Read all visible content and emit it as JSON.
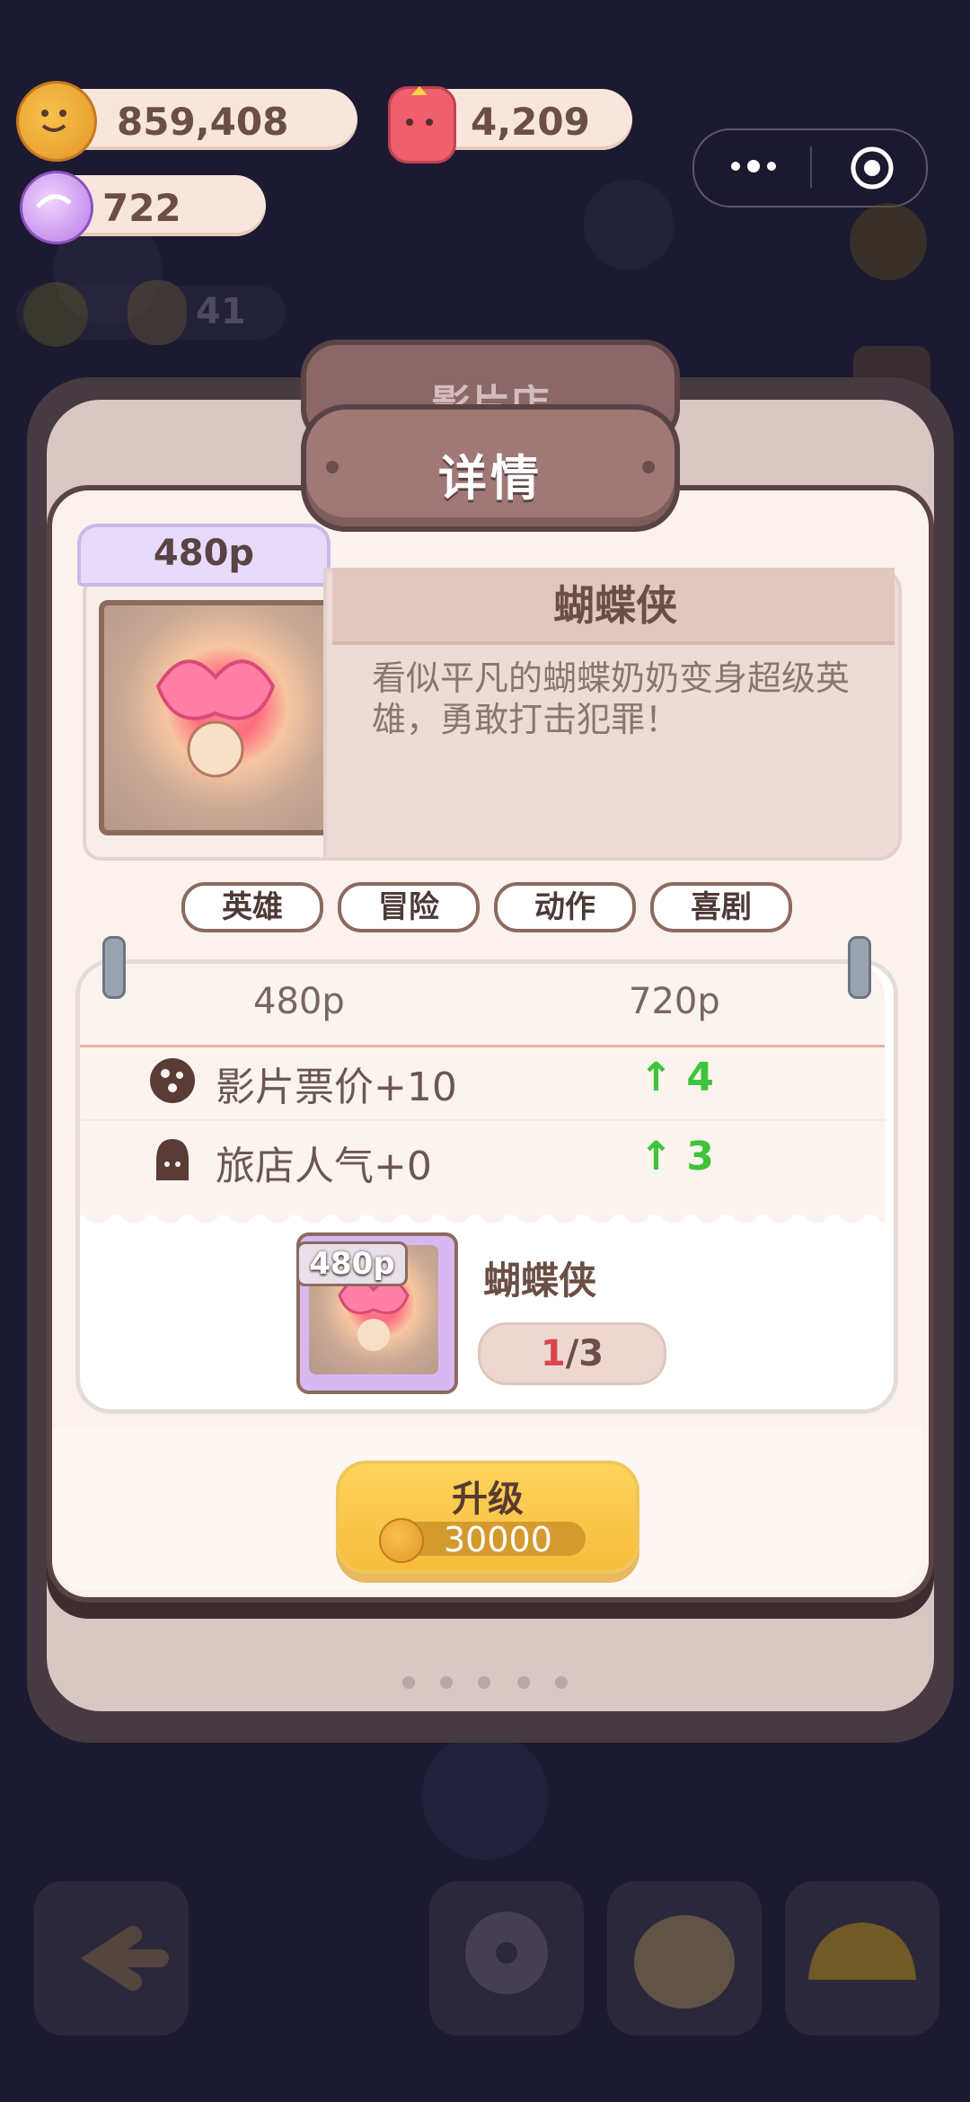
{
  "currencies": {
    "coins": "859,408",
    "jelly": "4,209",
    "crystals": "722"
  },
  "background": {
    "level_value": "41"
  },
  "mini_program": {
    "more_icon": "more-dots-icon",
    "close_icon": "target-close-icon"
  },
  "panel": {
    "back_title": "影片店",
    "title": "详情"
  },
  "movie": {
    "resolution": "480p",
    "name": "蝴蝶侠",
    "description": "看似平凡的蝴蝶奶奶变身超级英雄，勇敢打击犯罪！",
    "genres": [
      "英雄",
      "冒险",
      "动作",
      "喜剧"
    ]
  },
  "stats": {
    "current_res": "480p",
    "next_res": "720p",
    "rows": [
      {
        "icon": "cookie-icon",
        "label": "影片票价+10",
        "increase": "4"
      },
      {
        "icon": "popularity-icon",
        "label": "旅店人气+0",
        "increase": "3"
      }
    ]
  },
  "material": {
    "badge": "480p",
    "name": "蝴蝶侠",
    "have": "1",
    "need": "/3"
  },
  "upgrade": {
    "label": "升级",
    "cost": "30000"
  },
  "colors": {
    "accent_green": "#3ec43a",
    "button_yellow": "#f6bc3c",
    "panel_brown": "#5a4344"
  }
}
